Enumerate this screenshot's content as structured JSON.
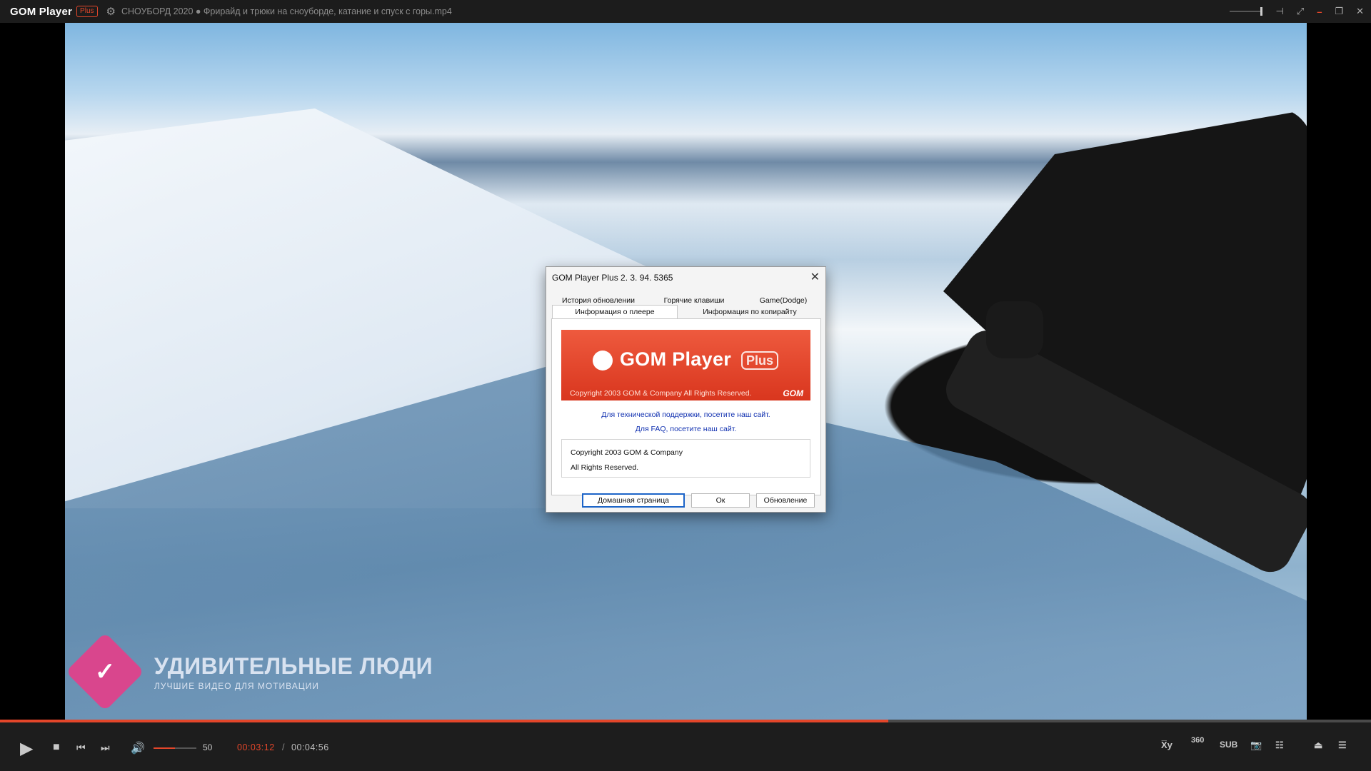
{
  "titlebar": {
    "app_name": "GOM Player",
    "badge": "Plus",
    "settings_icon": "gear-icon",
    "file_title": "СНОУБОРД 2020 ● Фрирайд и трюки на сноуборде, катание и спуск с горы.mp4",
    "pin_icon": "pin-icon",
    "fullscreen_icon": "fullscreen-icon",
    "minimize_icon": "minimize-icon",
    "restore_icon": "restore-icon",
    "close_icon": "close-icon"
  },
  "video": {
    "watermark_title": "УДИВИТЕЛЬНЫЕ ЛЮДИ",
    "watermark_subtitle": "ЛУЧШИЕ ВИДЕО ДЛЯ МОТИВАЦИИ"
  },
  "dialog": {
    "title": "GOM Player Plus 2. 3. 94. 5365",
    "tabs": {
      "history": "История обновлении",
      "hotkeys": "Горячие клавиши",
      "game": "Game(Dodge)",
      "player_info": "Информация о плеере",
      "copyright_info": "Информация по копирайту"
    },
    "banner": {
      "logo_text": "GOM Player",
      "plus_text": "Plus",
      "copyright": "Copyright 2003 GOM & Company All Rights Reserved.",
      "brand": "GOM"
    },
    "support_link": "Для технической поддержки, посетите наш сайт.",
    "faq_link": "Для FAQ, посетите наш сайт.",
    "info_line1": "Copyright 2003 GOM & Company",
    "info_line2": "All Rights Reserved.",
    "buttons": {
      "home": "Домашная страница",
      "ok": "Ок",
      "update": "Обновление"
    }
  },
  "controls": {
    "progress_fraction": 0.648,
    "volume": "50",
    "current_time": "00:03:12",
    "separator": "/",
    "total_time": "00:04:56",
    "btn_360": "360",
    "btn_sub": "SUB",
    "colors": {
      "accent": "#e3462a"
    }
  }
}
